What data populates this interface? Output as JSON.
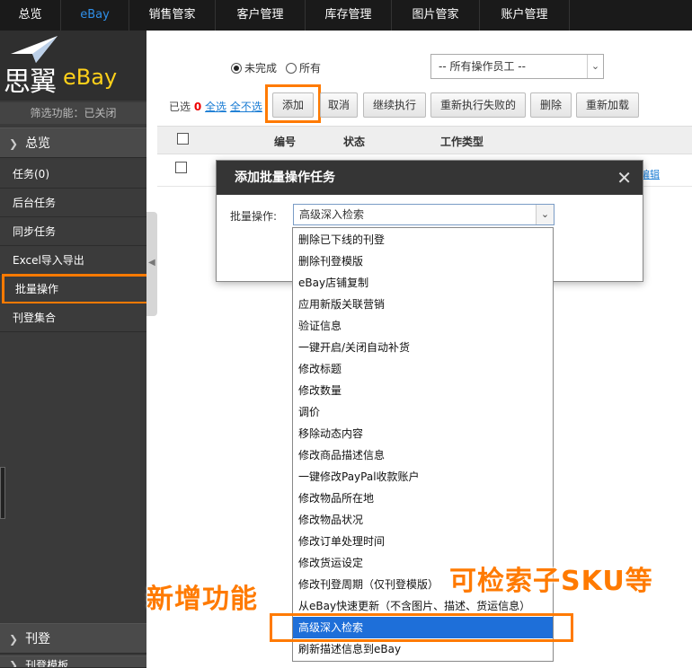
{
  "topnav": {
    "items": [
      "总览",
      "eBay",
      "销售管家",
      "客户管理",
      "库存管理",
      "图片管家",
      "账户管理"
    ],
    "active_index": 1
  },
  "sidebar": {
    "logo_text": "思翼",
    "logo_brand": "eBay",
    "filter_status": "筛选功能：已关闭",
    "section_top": "总览",
    "items": [
      "任务(0)",
      "后台任务",
      "同步任务",
      "Excel导入导出",
      "批量操作",
      "刊登集合"
    ],
    "highlighted_item": "批量操作",
    "section_bottom": "刊登",
    "section_bottom2": "刊登模板"
  },
  "filters": {
    "radio_incomplete": "未完成",
    "radio_all": "所有",
    "radio_selected": "未完成",
    "operator_select": "-- 所有操作员工 --"
  },
  "actions": {
    "selected_prefix": "已选",
    "selected_count": "0",
    "select_all": "全选",
    "select_none": "全不选",
    "buttons": [
      "添加",
      "取消",
      "继续执行",
      "重新执行失败的",
      "删除",
      "重新加载"
    ]
  },
  "table": {
    "headers": [
      "编号",
      "状态",
      "工作类型"
    ],
    "row_link_fragment": "编辑"
  },
  "dialog": {
    "title": "添加批量操作任务",
    "label": "批量操作:",
    "select_value": "高级深入检索",
    "options": [
      "删除已下线的刊登",
      "删除刊登模版",
      "eBay店铺复制",
      "应用新版关联营销",
      "验证信息",
      "一键开启/关闭自动补货",
      "修改标题",
      "修改数量",
      "调价",
      "移除动态内容",
      "修改商品描述信息",
      "一键修改PayPal收款账户",
      "修改物品所在地",
      "修改物品状况",
      "修改订单处理时间",
      "修改货运设定",
      "修改刊登周期（仅刊登模版）",
      "从eBay快速更新（不含图片、描述、货运信息）",
      "高级深入检索",
      "刷新描述信息到eBay"
    ],
    "selected_option": "高级深入检索"
  },
  "annotations": {
    "left": "新增功能",
    "right": "可检索子SKU等",
    "color": "#ff7a00"
  },
  "colors": {
    "accent_highlight": "#ff7a00",
    "nav_active": "#2f8fe8",
    "selected_option_bg": "#1e6fd9",
    "link": "#1a7cd4"
  }
}
